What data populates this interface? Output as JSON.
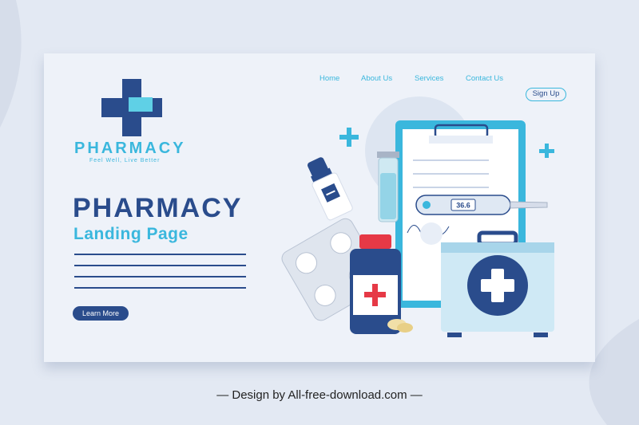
{
  "nav": {
    "items": [
      "Home",
      "About Us",
      "Services",
      "Contact Us"
    ],
    "signup": "Sign Up"
  },
  "brand": {
    "name": "PHARMACY",
    "tagline": "Feel Well, Live Better"
  },
  "hero": {
    "title": "PHARMACY",
    "subtitle": "Landing Page",
    "button": "Learn More"
  },
  "illustration": {
    "thermometer_reading": "36.6"
  },
  "credit": "— Design by All-free-download.com —",
  "colors": {
    "navy": "#2a4c8c",
    "cyan": "#3ab7dd",
    "red": "#e63946"
  }
}
